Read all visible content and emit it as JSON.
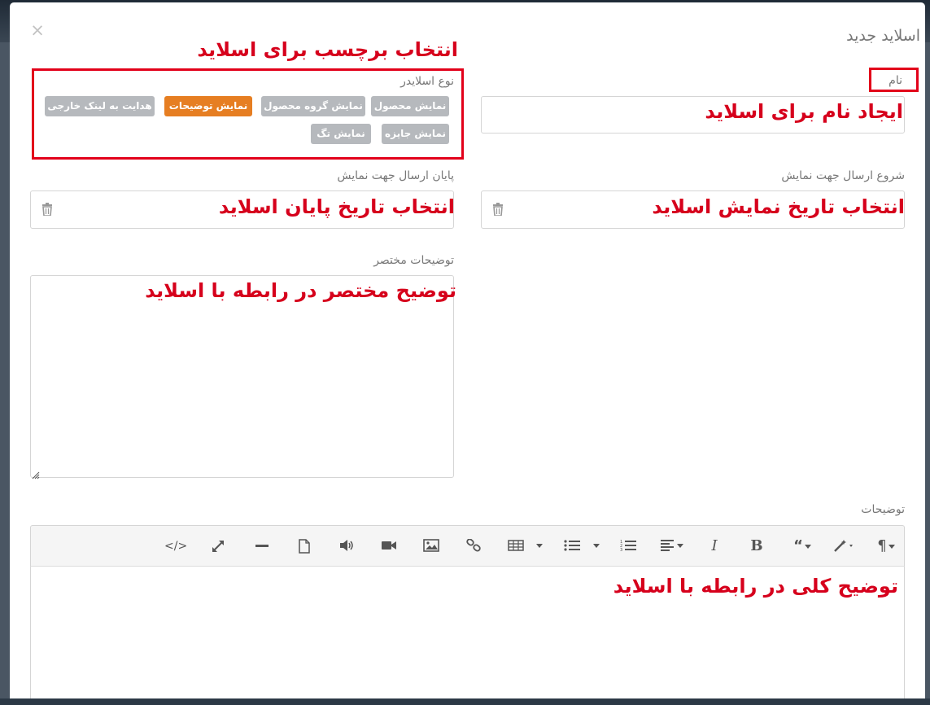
{
  "modal": {
    "title": "اسلاید جدید",
    "close_glyph": "×"
  },
  "form": {
    "name_label": "نام",
    "name_value": "",
    "slider_type_label": "نوع اسلایدر",
    "slider_types": [
      {
        "label": "نمایش محصول",
        "active": false
      },
      {
        "label": "نمایش گروه محصول",
        "active": false
      },
      {
        "label": "نمایش توضیحات",
        "active": true
      },
      {
        "label": "هدایت به لینک خارجی",
        "active": false
      },
      {
        "label": "نمایش جایزه",
        "active": false
      },
      {
        "label": "نمایش تگ",
        "active": false
      }
    ],
    "start_label": "شروع ارسال جهت نمایش",
    "end_label": "پایان ارسال جهت نمایش",
    "short_desc_label": "توضیحات مختصر",
    "description_label": "توضیحات"
  },
  "annotations": {
    "tag_select": "انتخاب برچسب برای اسلاید",
    "name_create": "ایجاد نام برای اسلاید",
    "start_date": "انتخاب تاریخ نمایش اسلاید",
    "end_date": "انتخاب تاریخ پایان اسلاید",
    "short_desc": "توضیح مختصر در رابطه با اسلاید",
    "full_desc": "توضیح کلی در رابطه با اسلاید"
  },
  "toolbar": {
    "icons": [
      "paragraph-icon",
      "magic-wand-icon",
      "quote-icon",
      "bold-icon",
      "italic-icon",
      "align-icon",
      "ordered-list-icon",
      "unordered-list-icon",
      "table-icon",
      "link-icon",
      "image-icon",
      "video-icon",
      "audio-icon",
      "file-icon",
      "horizontal-rule-icon",
      "fullscreen-icon",
      "code-view-icon"
    ]
  },
  "colors": {
    "accent": "#e67e22",
    "chip": "#b6b9bd",
    "annotation_red": "#d6001c"
  }
}
